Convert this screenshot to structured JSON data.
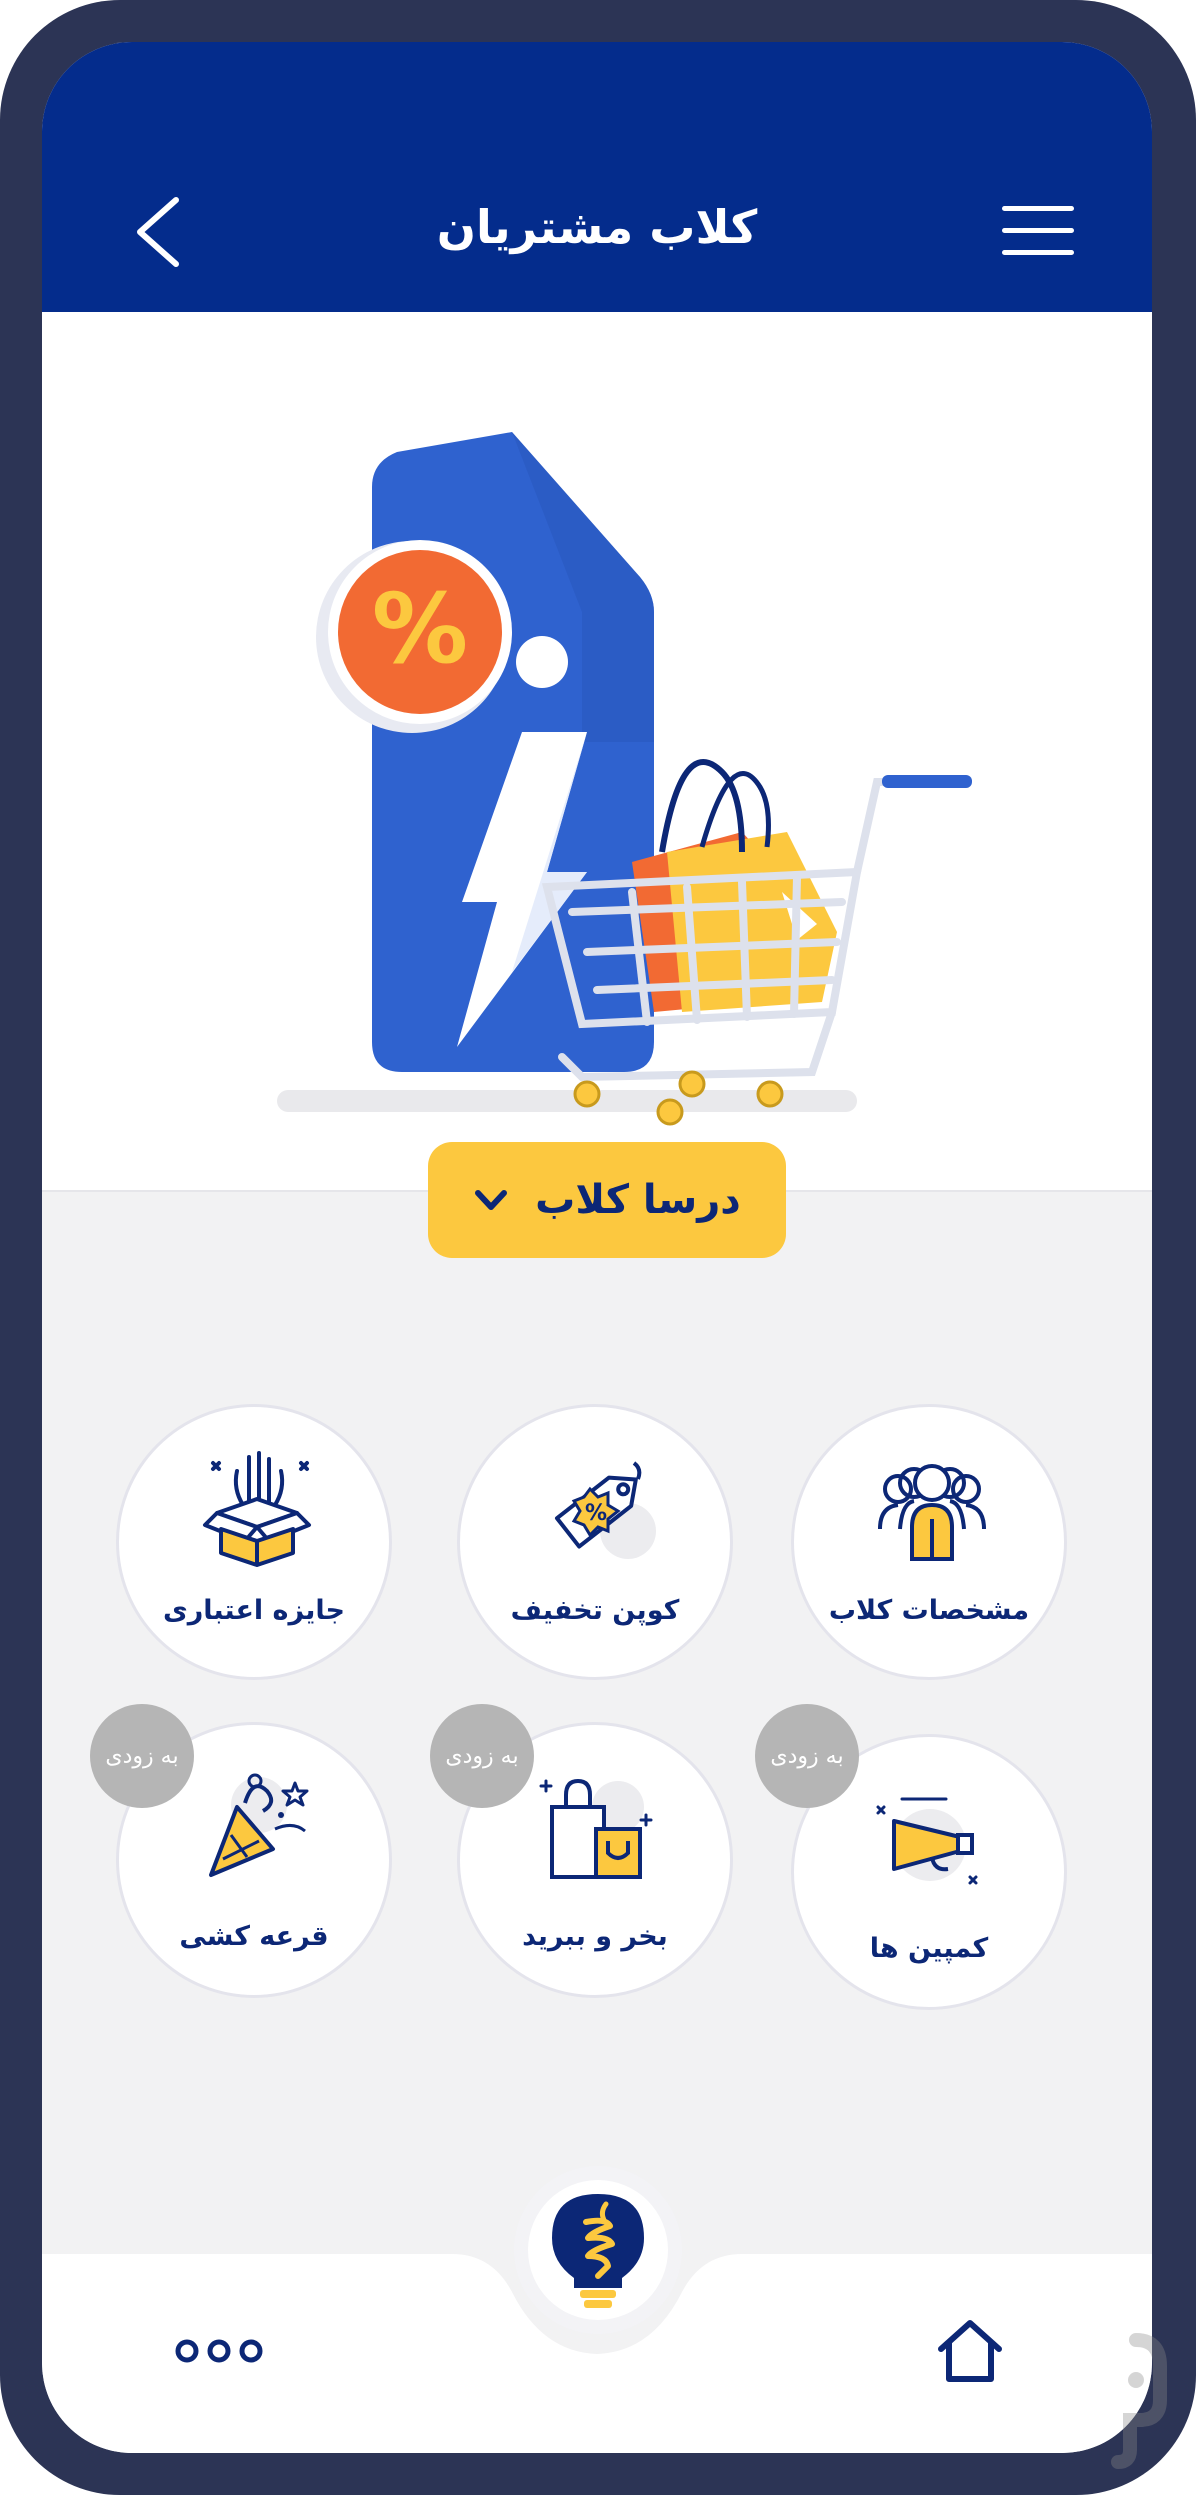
{
  "header": {
    "title": "کلاب مشتریان",
    "back_icon": "chevron-left-icon",
    "menu_icon": "hamburger-menu-icon",
    "bg_color": "#042c8c"
  },
  "hero": {
    "illustration": "discount-tag-shopping-cart-illustration",
    "badge_text": "%"
  },
  "club_selector": {
    "label": "درسا کلاب",
    "icon": "chevron-down-icon",
    "color": "#fcc83f"
  },
  "tiles": [
    {
      "label": "مشخصات کلاب",
      "icon": "group-people-icon"
    },
    {
      "label": "کوپن تخفیف",
      "icon": "coupon-tag-icon"
    },
    {
      "label": "جایزه اعتباری",
      "icon": "gift-box-icon"
    },
    {
      "label": "کمپین ها",
      "icon": "megaphone-icon",
      "badge": "به زودی"
    },
    {
      "label": "بخر و ببرید",
      "icon": "shopping-bags-icon",
      "badge": "به زودی"
    },
    {
      "label": "قرعه کشی",
      "icon": "party-popper-icon",
      "badge": "به زودی"
    }
  ],
  "bottom_nav": {
    "home_icon": "home-icon",
    "center_icon": "lightbulb-logo-icon",
    "more_icon": "more-dots-icon"
  },
  "colors": {
    "accent": "#fcc83f",
    "primary": "#042c8c",
    "text": "#0c2776",
    "badge": "#b5b5b5"
  }
}
